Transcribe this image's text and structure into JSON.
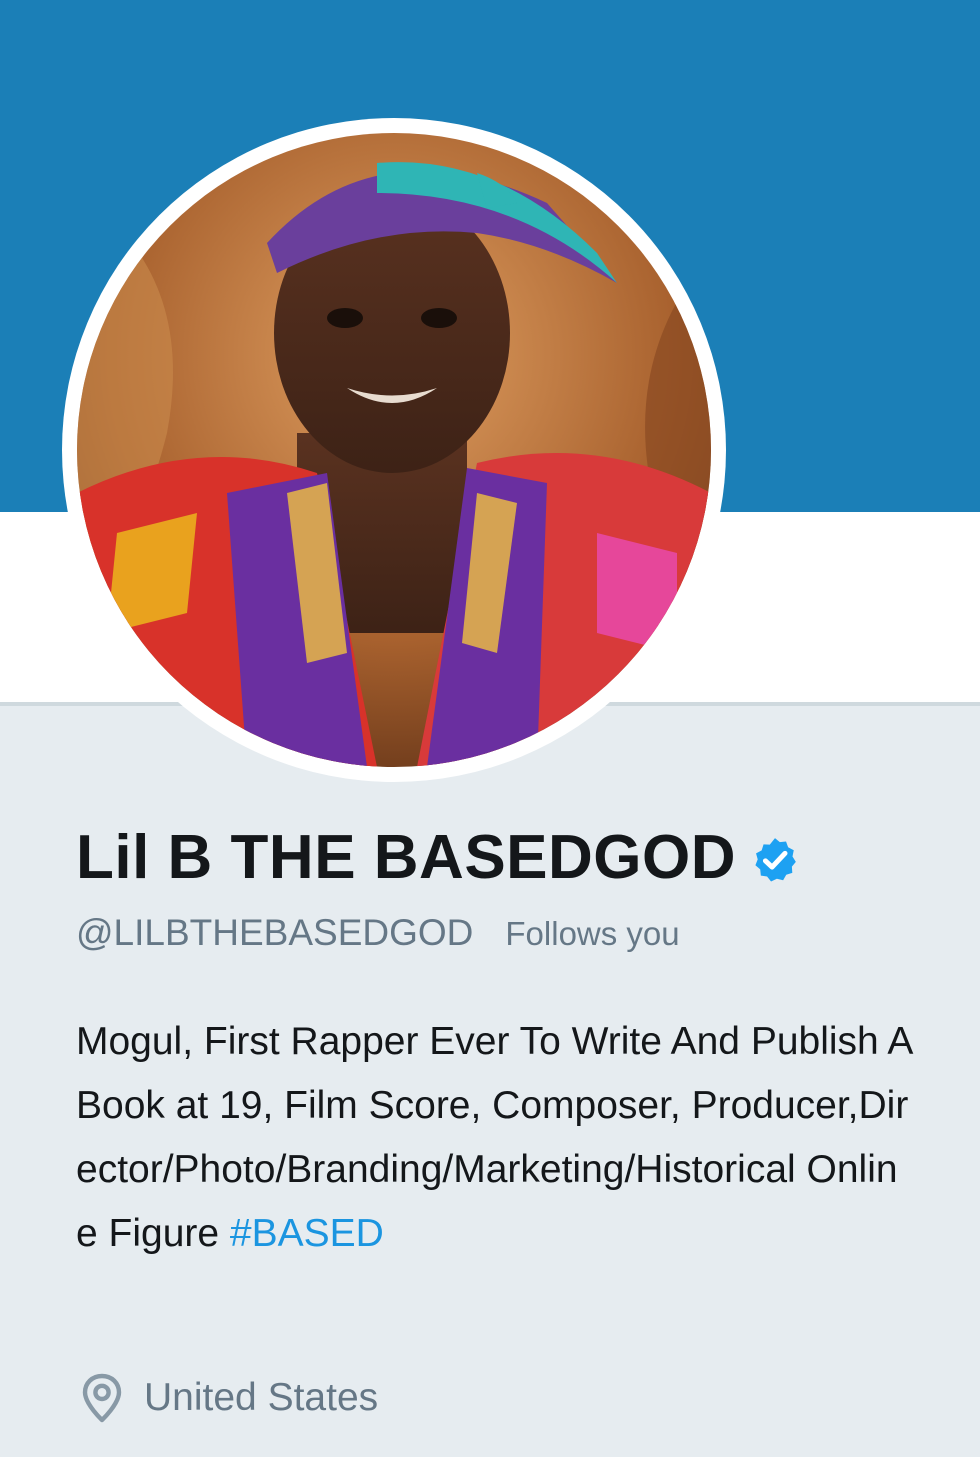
{
  "colors": {
    "banner": "#1b7fb7",
    "page_background": "#e6ecf0",
    "text_primary": "#14171a",
    "text_secondary": "#657786",
    "link": "#1b95e0",
    "verified_badge": "#1da1f2"
  },
  "profile": {
    "display_name": "Lil B THE BASEDGOD",
    "verified_icon": "verified-badge-icon",
    "handle": "@LILBTHEBASEDGOD",
    "follows_you_label": "Follows you",
    "bio_text": "Mogul, First Rapper Ever To Write And Publish A Book at 19, Film Score, Composer, Producer,Director/Photo/Branding/Marketing/Historical Online Figure ",
    "bio_hashtag": "#BASED",
    "location_icon": "location-pin-icon",
    "location": "United States"
  }
}
